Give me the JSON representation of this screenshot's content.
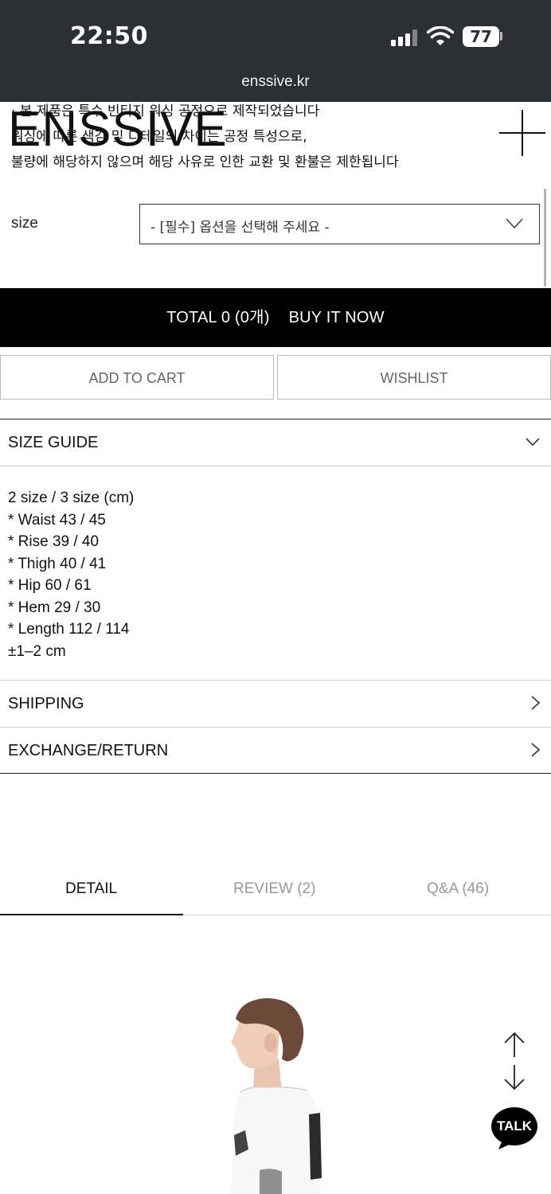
{
  "status_bar": {
    "time": "22:50",
    "battery": "77",
    "url": "enssive.kr"
  },
  "header": {
    "logo": "ENSSIVE",
    "menu_icon": "plus-icon"
  },
  "notice": {
    "lines": [
      "· 본 제품은 특수 빈티지 워싱 공정으로 제작되었습니다",
      "워싱에 따른 색감 및 디테일의 차이는 공정 특성으로,",
      "불량에 해당하지 않으며 해당 사유로 인한 교환 및 환불은 제한됩니다"
    ]
  },
  "option": {
    "label": "size",
    "placeholder": "- [필수] 옵션을 선택해 주세요 -"
  },
  "buy_bar": {
    "total": "TOTAL 0 (0개)",
    "buy_now": "BUY IT NOW"
  },
  "buttons": {
    "add_to_cart": "ADD TO CART",
    "wishlist": "WISHLIST"
  },
  "size_guide": {
    "title": "SIZE GUIDE",
    "lines": [
      "2 size / 3 size (cm)",
      "* Waist 43 / 45",
      "* Rise 39 / 40",
      "* Thigh 40 / 41",
      "* Hip 60 / 61",
      "* Hem 29 / 30",
      "* Length 112 / 114",
      "±1–2 cm"
    ]
  },
  "accordion": {
    "shipping": "SHIPPING",
    "exchange": "EXCHANGE/RETURN"
  },
  "tabs": {
    "detail": "DETAIL",
    "review": "REVIEW (2)",
    "qna": "Q&A (46)"
  },
  "floating": {
    "talk": "TALK"
  },
  "colors": {
    "status_bar_bg": "#2d3033",
    "buy_bar_bg": "#000000",
    "talk_bubble": "#000000"
  }
}
